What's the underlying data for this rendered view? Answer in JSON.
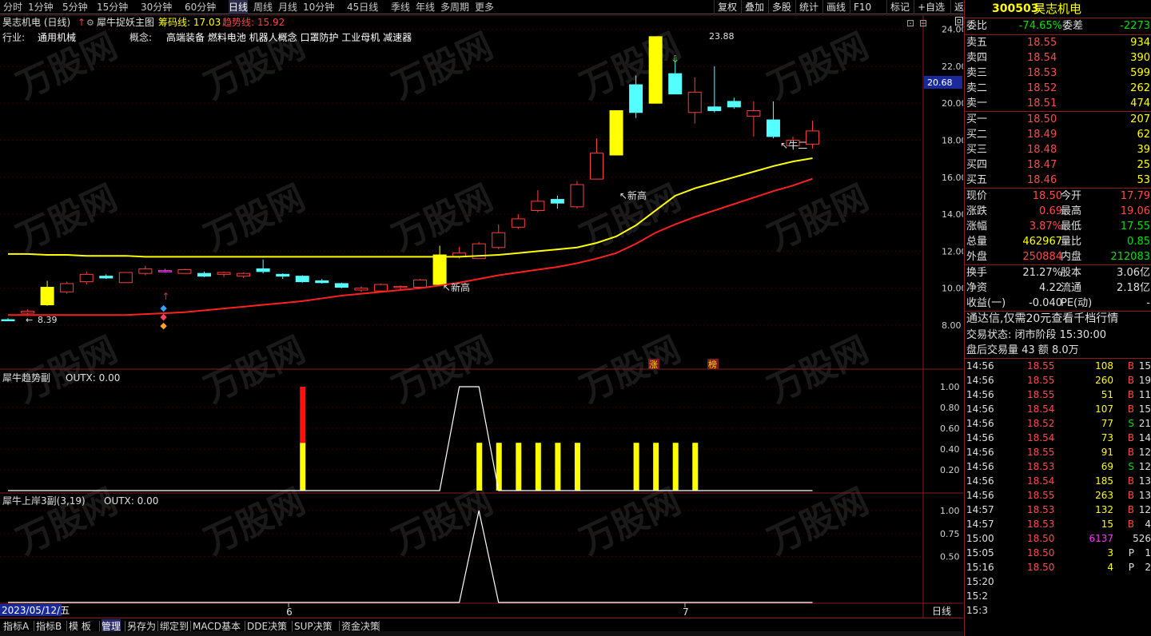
{
  "periods": [
    {
      "label": "分时",
      "active": false
    },
    {
      "label": "1分钟",
      "active": false
    },
    {
      "label": "5分钟",
      "active": false
    },
    {
      "label": "15分钟",
      "active": false
    },
    {
      "label": "30分钟",
      "active": false
    },
    {
      "label": "60分钟",
      "active": false
    },
    {
      "label": "日线",
      "active": true
    },
    {
      "label": "周线",
      "active": false
    },
    {
      "label": "月线",
      "active": false
    },
    {
      "label": "10分钟",
      "active": false
    },
    {
      "label": "45日线",
      "active": false
    },
    {
      "label": "季线",
      "active": false
    },
    {
      "label": "年线",
      "active": false
    },
    {
      "label": "多周期",
      "active": false
    },
    {
      "label": "更多",
      "active": false
    }
  ],
  "tools": [
    "复权",
    "叠加",
    "多股",
    "统计",
    "画线",
    "F10",
    "标记",
    "+自选",
    "返回"
  ],
  "main": {
    "stock_title": "昊志机电 (日线)",
    "indicator_name": "犀牛捉妖主图",
    "chip_label": "筹码线: 17.03",
    "trend_label": "趋势线: 15.92",
    "industry_label": "行业:",
    "industry_value": "通用机械",
    "concept_label": "概念:",
    "concept_value": "高端装备 燃料电池 机器人概念 口罩防护 工业母机 减速器",
    "high_label": "23.88",
    "low_label": "8.39",
    "price_tag": "20.68",
    "annotations": [
      "新高",
      "新高",
      "新高",
      "牛二"
    ],
    "badges": [
      "涨",
      "榜"
    ],
    "y_ticks": [
      "24.00",
      "22.00",
      "20.00",
      "18.00",
      "16.00",
      "14.00",
      "12.00",
      "10.00",
      "8.00"
    ]
  },
  "sub1": {
    "title": "犀牛趋势副",
    "outx": "OUTX: 0.00",
    "y_ticks": [
      "1.00",
      "0.80",
      "0.60",
      "0.40",
      "0.20"
    ]
  },
  "sub2": {
    "title": "犀牛上岸3副(3,19)",
    "outx": "OUTX: 0.00",
    "y_ticks": [
      "1.00",
      "0.75",
      "0.50"
    ]
  },
  "xaxis": {
    "date_label": "2023/05/12/五",
    "month_ticks": [
      "6",
      "7"
    ],
    "period_label": "日线"
  },
  "bottom_tabs": [
    "指标A",
    "指标B",
    "模 板",
    "管理",
    "另存为",
    "绑定到",
    "MACD基本",
    "DDE决策",
    "SUP决策",
    "资金决策"
  ],
  "right_panel": {
    "code": "300503",
    "name": "昊志机电",
    "weibi_label": "委比",
    "weibi": "-74.65%",
    "weicha_label": "委差",
    "weicha": "-2273",
    "asks": [
      {
        "label": "卖五",
        "price": "18.55",
        "vol": "934"
      },
      {
        "label": "卖四",
        "price": "18.54",
        "vol": "390"
      },
      {
        "label": "卖三",
        "price": "18.53",
        "vol": "599"
      },
      {
        "label": "卖二",
        "price": "18.52",
        "vol": "262"
      },
      {
        "label": "卖一",
        "price": "18.51",
        "vol": "474"
      }
    ],
    "bids": [
      {
        "label": "买一",
        "price": "18.50",
        "vol": "207"
      },
      {
        "label": "买二",
        "price": "18.49",
        "vol": "62"
      },
      {
        "label": "买三",
        "price": "18.48",
        "vol": "39"
      },
      {
        "label": "买四",
        "price": "18.47",
        "vol": "25"
      },
      {
        "label": "买五",
        "price": "18.46",
        "vol": "53"
      }
    ],
    "stats": [
      [
        "现价",
        "18.50",
        "今开",
        "17.79"
      ],
      [
        "涨跌",
        "0.69",
        "最高",
        "19.06"
      ],
      [
        "涨幅",
        "3.87%",
        "最低",
        "17.55"
      ],
      [
        "总量",
        "462967",
        "量比",
        "0.85"
      ],
      [
        "外盘",
        "250884",
        "内盘",
        "212083"
      ],
      [
        "换手",
        "21.27%",
        "股本",
        "3.06亿"
      ],
      [
        "净资",
        "4.22",
        "流通",
        "2.18亿"
      ],
      [
        "收益(一)",
        "-0.040",
        "PE(动)",
        "-"
      ]
    ],
    "promo": "通达信,仅需20元查看千档行情",
    "status": "交易状态: 闭市阶段 15:30:00",
    "after": "盘后交易量 43 额 8.0万",
    "ticks": [
      [
        "14:56",
        "18.55",
        "108",
        "B",
        "15"
      ],
      [
        "14:56",
        "18.55",
        "260",
        "B",
        "19"
      ],
      [
        "14:56",
        "18.55",
        "51",
        "B",
        "11"
      ],
      [
        "14:56",
        "18.54",
        "107",
        "B",
        "15"
      ],
      [
        "14:56",
        "18.52",
        "77",
        "S",
        "21"
      ],
      [
        "14:56",
        "18.54",
        "73",
        "B",
        "14"
      ],
      [
        "14:56",
        "18.55",
        "91",
        "B",
        "12"
      ],
      [
        "14:56",
        "18.53",
        "69",
        "S",
        "12"
      ],
      [
        "14:56",
        "18.54",
        "185",
        "B",
        "13"
      ],
      [
        "14:56",
        "18.55",
        "263",
        "B",
        "13"
      ],
      [
        "14:57",
        "18.53",
        "132",
        "B",
        "12"
      ],
      [
        "14:57",
        "18.53",
        "15",
        "B",
        "4"
      ],
      [
        "15:00",
        "18.50",
        "6137",
        "",
        "526"
      ],
      [
        "15:05",
        "18.50",
        "3",
        "P",
        "1"
      ],
      [
        "15:16",
        "18.50",
        "4",
        "P",
        "2"
      ],
      [
        "15:20",
        "",
        "",
        "",
        ""
      ],
      [
        "15:2",
        "",
        "",
        "",
        ""
      ],
      [
        "15:3",
        "",
        "",
        "",
        ""
      ]
    ]
  },
  "colors": {
    "up": "#ff3c3c",
    "down": "#54ffff",
    "chip": "#ffff00",
    "trend": "#ff2020",
    "signal": "#ffff00"
  },
  "chart_data": {
    "type": "candlestick",
    "candles": [
      [
        8.3,
        8.3,
        8.25,
        8.38,
        "down"
      ],
      [
        8.65,
        8.75,
        8.5,
        8.85,
        "up"
      ],
      [
        9.1,
        10.05,
        9.05,
        10.4,
        "up"
      ],
      [
        9.8,
        10.25,
        9.7,
        10.35,
        "up"
      ],
      [
        10.35,
        10.75,
        10.2,
        10.9,
        "up"
      ],
      [
        10.55,
        10.65,
        10.5,
        10.75,
        "down"
      ],
      [
        10.3,
        10.85,
        10.3,
        10.85,
        "up"
      ],
      [
        10.8,
        11.05,
        10.7,
        11.2,
        "up"
      ],
      [
        10.95,
        10.9,
        10.85,
        11.05,
        "up"
      ],
      [
        10.8,
        11.0,
        10.8,
        11.05,
        "up"
      ],
      [
        10.8,
        10.65,
        10.6,
        10.9,
        "down"
      ],
      [
        10.85,
        10.75,
        10.6,
        10.9,
        "up"
      ],
      [
        10.65,
        10.8,
        10.55,
        10.85,
        "up"
      ],
      [
        11.05,
        10.9,
        10.8,
        11.55,
        "down"
      ],
      [
        10.75,
        10.65,
        10.5,
        10.8,
        "down"
      ],
      [
        10.65,
        10.35,
        10.3,
        10.7,
        "down"
      ],
      [
        10.4,
        10.3,
        10.25,
        10.5,
        "down"
      ],
      [
        10.25,
        10.05,
        10.0,
        10.3,
        "down"
      ],
      [
        9.9,
        10.0,
        9.8,
        10.1,
        "up"
      ],
      [
        9.85,
        10.2,
        9.8,
        10.25,
        "up"
      ],
      [
        10.05,
        10.1,
        9.9,
        10.15,
        "up"
      ],
      [
        10.05,
        10.45,
        10.0,
        10.5,
        "up"
      ],
      [
        10.2,
        11.8,
        10.1,
        12.3,
        "up"
      ],
      [
        11.7,
        11.9,
        11.6,
        12.25,
        "up"
      ],
      [
        11.6,
        12.4,
        11.6,
        12.5,
        "up"
      ],
      [
        12.2,
        13.0,
        12.1,
        13.45,
        "up"
      ],
      [
        13.3,
        13.75,
        13.2,
        14.0,
        "up"
      ],
      [
        14.2,
        14.7,
        14.1,
        15.3,
        "up"
      ],
      [
        14.6,
        14.8,
        14.3,
        15.0,
        "down"
      ],
      [
        14.4,
        15.6,
        14.3,
        15.8,
        "up"
      ],
      [
        15.9,
        17.3,
        15.9,
        18.1,
        "up"
      ],
      [
        17.2,
        19.6,
        17.2,
        19.6,
        "up"
      ],
      [
        19.5,
        21.0,
        19.2,
        21.5,
        "down"
      ],
      [
        20.0,
        23.6,
        20.0,
        23.6,
        "up"
      ],
      [
        21.6,
        20.5,
        20.5,
        22.3,
        "down"
      ],
      [
        19.5,
        20.6,
        18.9,
        21.4,
        "up"
      ],
      [
        19.6,
        19.8,
        19.5,
        22.0,
        "down"
      ],
      [
        19.8,
        20.1,
        19.7,
        20.3,
        "down"
      ],
      [
        19.3,
        19.6,
        18.2,
        20.1,
        "up"
      ],
      [
        19.1,
        18.2,
        18.1,
        20.1,
        "down"
      ],
      [
        17.7,
        18.0,
        17.55,
        18.2,
        "up"
      ],
      [
        17.79,
        18.5,
        17.55,
        19.06,
        "up"
      ]
    ],
    "chip_line": [
      11.85,
      11.85,
      11.8,
      11.8,
      11.75,
      11.75,
      11.75,
      11.7,
      11.7,
      11.7,
      11.7,
      11.7,
      11.7,
      11.7,
      11.7,
      11.7,
      11.7,
      11.7,
      11.7,
      11.7,
      11.7,
      11.7,
      11.7,
      11.7,
      11.75,
      11.8,
      11.9,
      12.0,
      12.1,
      12.2,
      12.45,
      12.8,
      13.4,
      14.2,
      15.0,
      15.4,
      15.7,
      16.0,
      16.3,
      16.6,
      16.85,
      17.03
    ],
    "trend_line": [
      8.55,
      8.55,
      8.55,
      8.55,
      8.55,
      8.55,
      8.55,
      8.6,
      8.65,
      8.7,
      8.8,
      8.9,
      9.0,
      9.1,
      9.2,
      9.3,
      9.45,
      9.6,
      9.7,
      9.8,
      9.9,
      10.0,
      10.15,
      10.3,
      10.5,
      10.7,
      10.85,
      11.0,
      11.15,
      11.35,
      11.6,
      11.9,
      12.4,
      13.0,
      13.45,
      13.85,
      14.2,
      14.55,
      14.9,
      15.25,
      15.55,
      15.92
    ],
    "sub1_bars": [
      [
        15,
        0.46,
        1.0
      ],
      [
        24,
        0.46,
        0
      ],
      [
        25,
        0.46,
        0
      ],
      [
        26,
        0.46,
        0
      ],
      [
        27,
        0.46,
        0
      ],
      [
        28,
        0.46,
        0
      ],
      [
        29,
        0.46,
        0
      ],
      [
        32,
        0.46,
        0
      ],
      [
        33,
        0.46,
        0
      ],
      [
        34,
        0.46,
        0
      ],
      [
        35,
        0.46,
        0
      ]
    ],
    "sub1_line": [
      0,
      0,
      0,
      0,
      0,
      0,
      0,
      0,
      0,
      0,
      0,
      0,
      0,
      0,
      0,
      0,
      0,
      0,
      0,
      0,
      0,
      0,
      0,
      1,
      1,
      0,
      0,
      0,
      0,
      0,
      0,
      0,
      0,
      0,
      0,
      0,
      0,
      0,
      0,
      0,
      0,
      0
    ],
    "sub2_line": [
      0,
      0,
      0,
      0,
      0,
      0,
      0,
      0,
      0,
      0,
      0,
      0,
      0,
      0,
      0,
      0,
      0,
      0,
      0,
      0,
      0,
      0,
      0,
      0,
      1,
      0,
      0,
      0,
      0,
      0,
      0,
      0,
      0,
      0,
      0,
      0,
      0,
      0,
      0,
      0,
      0,
      0
    ]
  }
}
